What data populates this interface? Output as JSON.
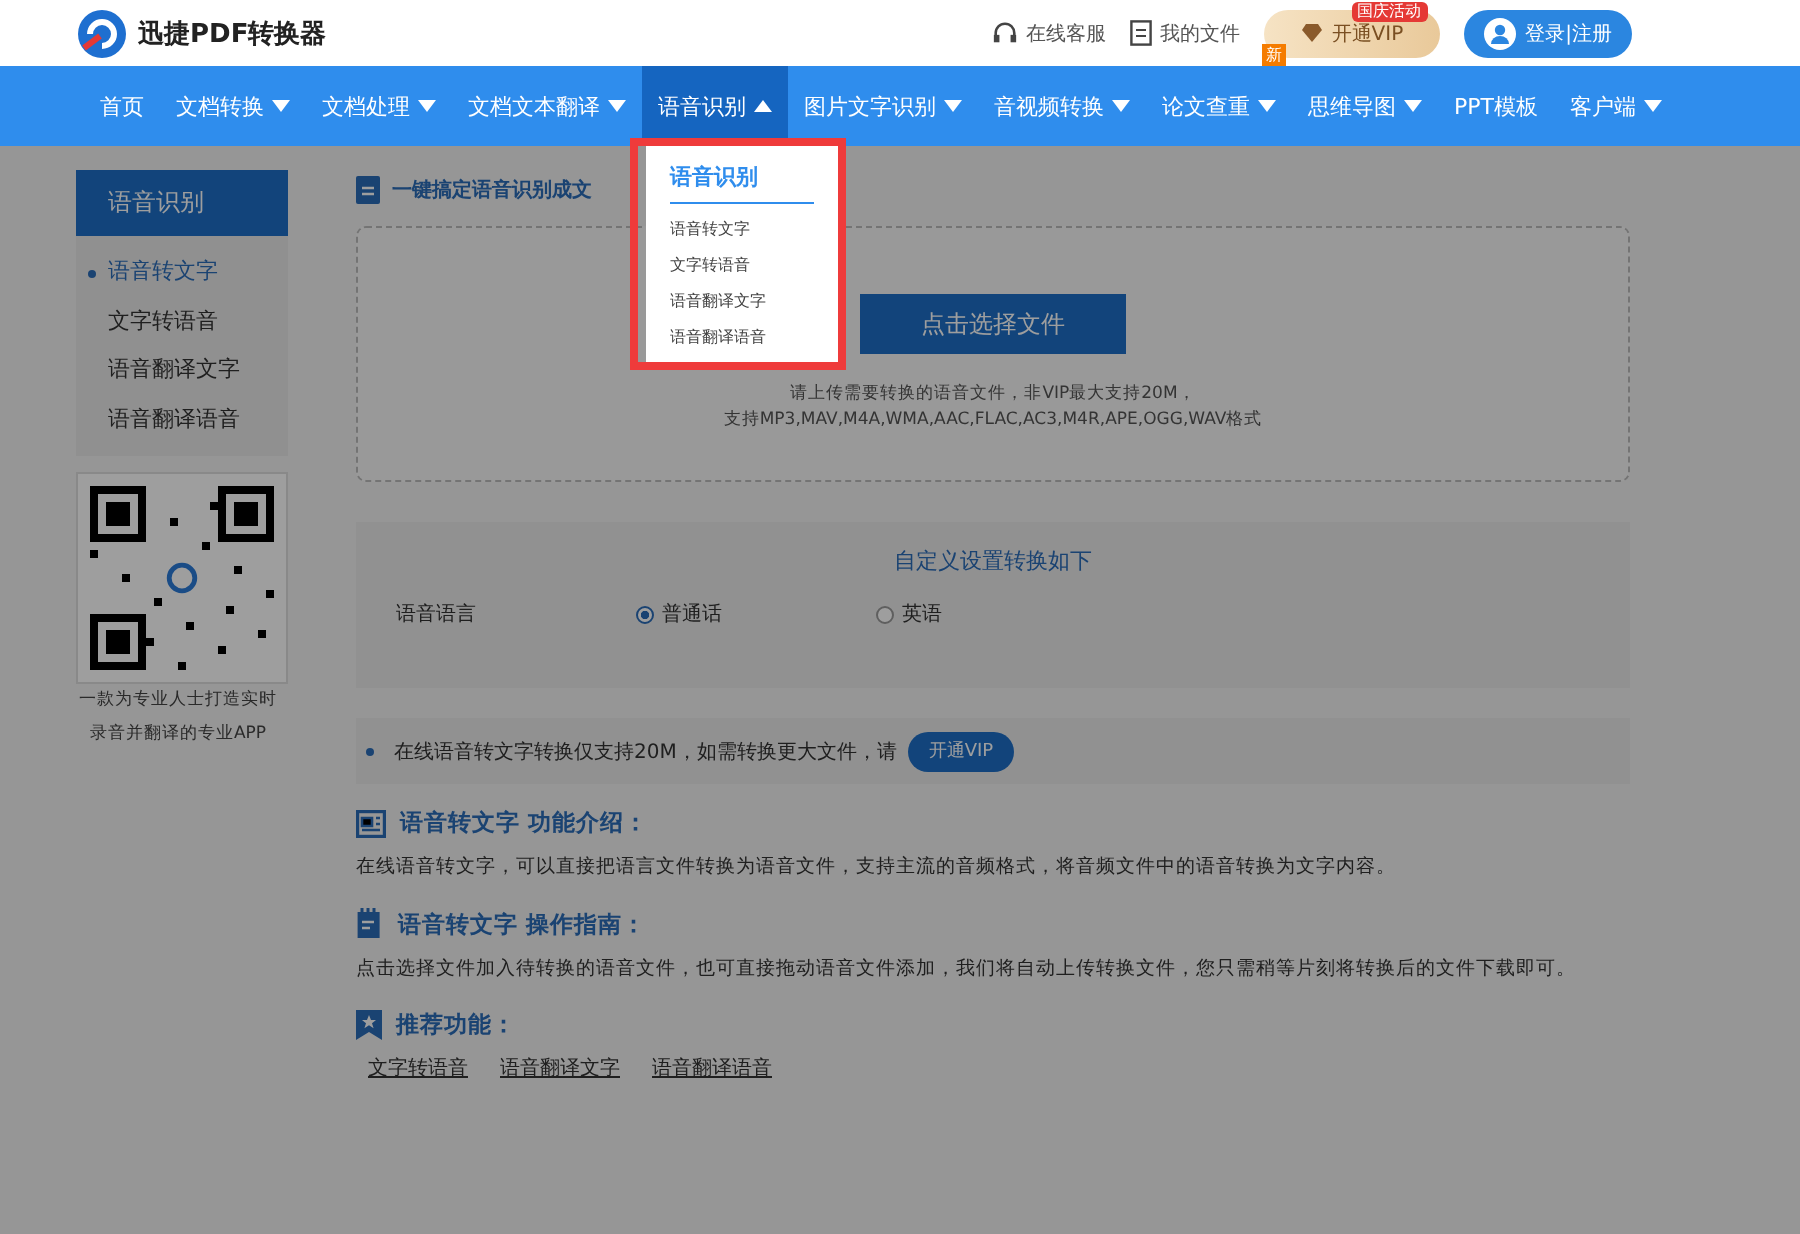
{
  "header": {
    "logo_text": "迅捷PDF转换器",
    "service": "在线客服",
    "my_files": "我的文件",
    "vip_button": "开通VIP",
    "vip_badge": "国庆活动",
    "login": "登录|注册"
  },
  "nav": [
    {
      "label": "首页",
      "has_menu": false,
      "selected": false
    },
    {
      "label": "文档转换",
      "has_menu": true,
      "selected": false
    },
    {
      "label": "文档处理",
      "has_menu": true,
      "selected": false
    },
    {
      "label": "文档文本翻译",
      "has_menu": true,
      "selected": false
    },
    {
      "label": "语音识别",
      "has_menu": true,
      "selected": true
    },
    {
      "label": "图片文字识别",
      "has_menu": true,
      "selected": false
    },
    {
      "label": "音视频转换",
      "has_menu": true,
      "selected": false
    },
    {
      "label": "论文查重",
      "has_menu": true,
      "selected": false,
      "badge": "新"
    },
    {
      "label": "思维导图",
      "has_menu": true,
      "selected": false
    },
    {
      "label": "PPT模板",
      "has_menu": false,
      "selected": false
    },
    {
      "label": "客户端",
      "has_menu": true,
      "selected": false
    }
  ],
  "dropdown": {
    "title": "语音识别",
    "items": [
      "语音转文字",
      "文字转语音",
      "语音翻译文字",
      "语音翻译语音"
    ]
  },
  "sidebar": {
    "title": "语音识别",
    "items": [
      {
        "label": "语音转文字",
        "selected": true
      },
      {
        "label": "文字转语音",
        "selected": false
      },
      {
        "label": "语音翻译文字",
        "selected": false
      },
      {
        "label": "语音翻译语音",
        "selected": false
      }
    ],
    "qr_caption": [
      "一款为专业人士打造实时",
      "录音并翻译的专业APP"
    ]
  },
  "main": {
    "title": "一键搞定语音识别成文",
    "upload_button": "点击选择文件",
    "upload_hint": [
      "请上传需要转换的语音文件，非VIP最大支持20M，",
      "支持MP3,MAV,M4A,WMA,AAC,FLAC,AC3,M4R,APE,OGG,WAV格式"
    ],
    "settings": {
      "title": "自定义设置转换如下",
      "label": "语音语言",
      "options": [
        {
          "label": "普通话",
          "selected": true
        },
        {
          "label": "英语",
          "selected": false
        }
      ]
    },
    "notice": {
      "text": "在线语音转文字转换仅支持20M，如需转换更大文件，请",
      "button": "开通VIP"
    },
    "sections": [
      {
        "kind": "intro",
        "title": "语音转文字 功能介绍：",
        "text": "在线语音转文字，可以直接把语言文件转换为语音文件，支持主流的音频格式，将音频文件中的语音转换为文字内容。"
      },
      {
        "kind": "guide",
        "title": "语音转文字 操作指南：",
        "text": "点击选择文件加入待转换的语音文件，也可直接拖动语音文件添加，我们将自动上传转换文件，您只需稍等片刻将转换后的文件下载即可。"
      },
      {
        "kind": "recommend",
        "title": "推荐功能：",
        "links": [
          "文字转语音",
          "语音翻译文字",
          "语音翻译语音"
        ]
      }
    ]
  }
}
